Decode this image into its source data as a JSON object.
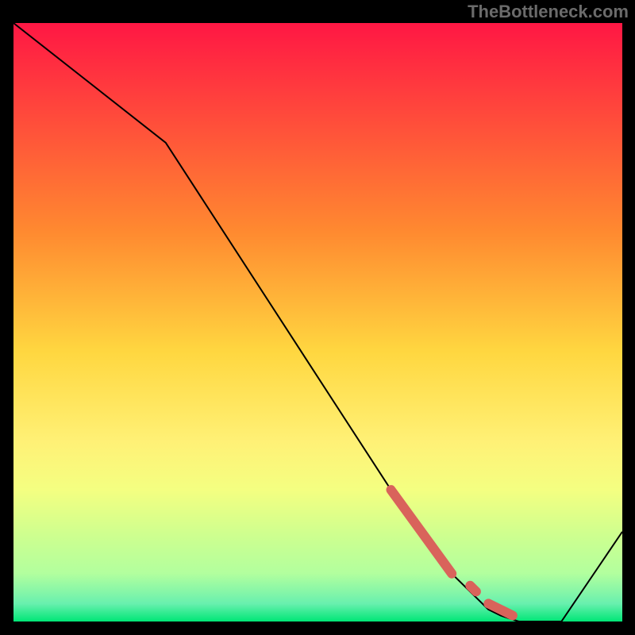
{
  "watermark": "TheBottleneck.com",
  "chart_data": {
    "type": "line",
    "title": "",
    "xlabel": "",
    "ylabel": "",
    "xlim": [
      0,
      100
    ],
    "ylim": [
      0,
      100
    ],
    "gradient_stops": [
      {
        "offset": 0,
        "color": "#ff1744"
      },
      {
        "offset": 35,
        "color": "#ff8a30"
      },
      {
        "offset": 55,
        "color": "#ffd740"
      },
      {
        "offset": 70,
        "color": "#fff176"
      },
      {
        "offset": 78,
        "color": "#f4ff81"
      },
      {
        "offset": 86,
        "color": "#ccff90"
      },
      {
        "offset": 92,
        "color": "#b2ff9e"
      },
      {
        "offset": 97,
        "color": "#69f0ae"
      },
      {
        "offset": 100,
        "color": "#00e676"
      }
    ],
    "line": {
      "x": [
        0,
        25,
        62,
        72,
        78,
        80,
        83,
        90,
        100
      ],
      "y": [
        100,
        80,
        22,
        8,
        2,
        1,
        0,
        0,
        15
      ]
    },
    "highlight_segments": [
      {
        "x0": 62,
        "y0": 22,
        "x1": 72,
        "y1": 8
      },
      {
        "x0": 75,
        "y0": 6,
        "x1": 76,
        "y1": 5
      },
      {
        "x0": 78,
        "y0": 3,
        "x1": 82,
        "y1": 1
      }
    ],
    "highlight_color": "#d9635b",
    "line_color": "#000000"
  }
}
